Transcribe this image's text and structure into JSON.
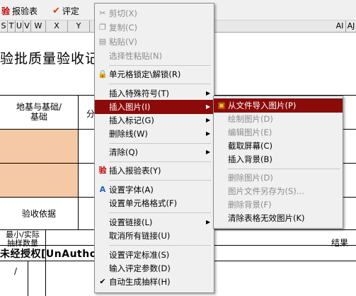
{
  "toolbar": {
    "report_label": "报验表",
    "report_icon": "验",
    "evaluate_label": "评定"
  },
  "columns": [
    "S",
    "T",
    "U",
    "V",
    "W",
    "X",
    "Y",
    "AI",
    "AJ"
  ],
  "document": {
    "title": "验批质量验收记",
    "table_header": "地基与基础/\n基础",
    "table_header_right": "分",
    "acceptance_basis": "验收依据",
    "left_header": "最小/实际\n抽样数量",
    "right_header": "结果",
    "unauthorized": "未经授权[UnAuthoriz",
    "slash": "/"
  },
  "context_menu": {
    "items": [
      {
        "label": "剪切(X)",
        "icon": "scissors-icon",
        "glyph": "✂",
        "disabled": true
      },
      {
        "label": "复制(C)",
        "icon": "copy-icon",
        "glyph": "❐",
        "disabled": true
      },
      {
        "label": "粘贴(V)",
        "icon": "paste-icon",
        "glyph": "📋",
        "disabled": true
      },
      {
        "label": "选择性粘贴(N)",
        "disabled": true
      },
      {
        "label": "单元格锁定\\解锁(R)",
        "icon": "lock-icon",
        "glyph": "🔒"
      },
      {
        "label": "插入特殊符号(T)",
        "submenu": true
      },
      {
        "label": "插入图片(I)",
        "submenu": true,
        "highlighted": true
      },
      {
        "label": "插入标记(G)",
        "submenu": true
      },
      {
        "label": "删除线(W)",
        "submenu": true
      },
      {
        "label": "清除(Q)",
        "submenu": true
      },
      {
        "label": "插入报验表(Y)",
        "icon": "report-icon",
        "glyph": "验"
      },
      {
        "label": "设置字体(A)",
        "icon": "font-icon",
        "glyph": "A"
      },
      {
        "label": "设置单元格格式(F)"
      },
      {
        "label": "设置链接(L)",
        "submenu": true
      },
      {
        "label": "取消所有链接(U)"
      },
      {
        "label": "设置评定标准(S)"
      },
      {
        "label": "输入评定参数(D)"
      },
      {
        "label": "自动生成抽样(H)",
        "checked": true
      }
    ]
  },
  "submenu": {
    "items": [
      {
        "label": "从文件导入图片(P)",
        "icon": "image-icon",
        "highlighted": true
      },
      {
        "label": "绘制图片(D)",
        "disabled": true
      },
      {
        "label": "编辑图片(E)",
        "disabled": true
      },
      {
        "label": "截取屏幕(C)"
      },
      {
        "label": "插入背景(B)"
      },
      {
        "label": "删除图片(D)",
        "disabled": true
      },
      {
        "label": "图片文件另存为(S)...",
        "disabled": true
      },
      {
        "label": "删除背景(F)",
        "disabled": true
      },
      {
        "label": "清除表格无效图片(K)"
      }
    ]
  }
}
